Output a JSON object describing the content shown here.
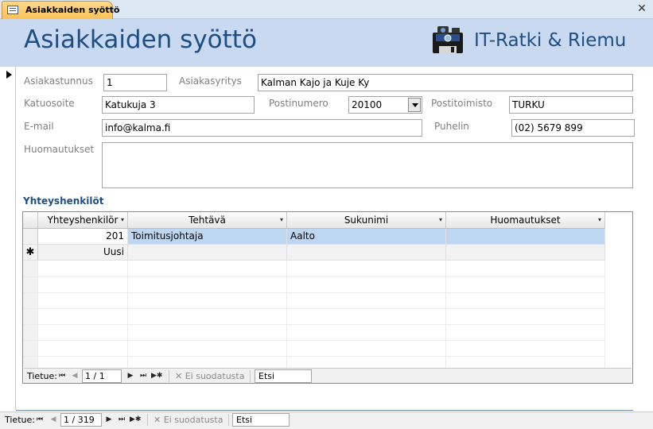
{
  "tab": {
    "title": "Asiakkaiden syöttö",
    "icon": "form-icon",
    "close": "✕"
  },
  "header": {
    "title": "Asiakkaiden syöttö",
    "brand": "IT-Ratki & Riemu",
    "logo_icon": "camera-disk-icon"
  },
  "fields": {
    "asiakastunnus": {
      "label": "Asiakastunnus",
      "value": "1"
    },
    "asiakasyritys": {
      "label": "Asiakasyritys",
      "value": "Kalman Kajo ja Kuje Ky"
    },
    "katuosoite": {
      "label": "Katuosoite",
      "value": "Katukuja 3"
    },
    "postinumero": {
      "label": "Postinumero",
      "value": "20100"
    },
    "postitoimisto": {
      "label": "Postitoimisto",
      "value": "TURKU"
    },
    "email": {
      "label": "E-mail",
      "value": "info@kalma.fi"
    },
    "puhelin": {
      "label": "Puhelin",
      "value": "(02) 5679 899"
    },
    "huomautukset": {
      "label": "Huomautukset",
      "value": ""
    }
  },
  "subform": {
    "title": "Yhteyshenkilöt",
    "columns": [
      "Yhteyshenkilör",
      "Tehtävä",
      "Sukunimi",
      "Huomautukset"
    ],
    "rows": [
      {
        "id": "201",
        "tehtava": "Toimitusjohtaja",
        "sukunimi": "Aalto",
        "huomautukset": ""
      }
    ],
    "new_row": {
      "marker": "✱",
      "label": "Uusi"
    },
    "nav": {
      "label": "Tietue:",
      "position": "1 / 1",
      "filter": "Ei suodatusta",
      "search": "Etsi"
    }
  },
  "main_nav": {
    "label": "Tietue:",
    "position": "1 / 319",
    "filter": "Ei suodatusta",
    "search": "Etsi"
  },
  "colors": {
    "header_bg": "#c8d9f0",
    "title": "#1f4e84",
    "tab": "#fcc25a",
    "selected_row": "#bdd7f3"
  }
}
